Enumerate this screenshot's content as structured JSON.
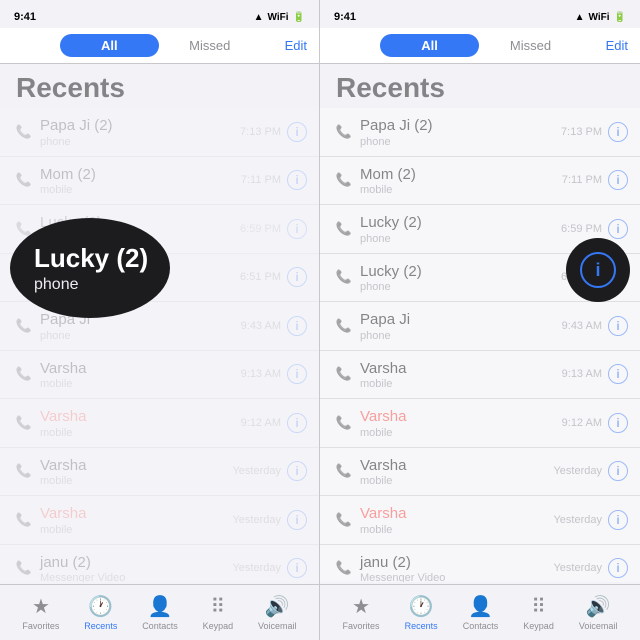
{
  "panels": [
    {
      "id": "left",
      "status": {
        "time": "9:41",
        "signal": "4G",
        "wifi": true,
        "battery": "100%"
      },
      "tabs": {
        "all_label": "All",
        "missed_label": "Missed",
        "edit_label": "Edit",
        "active": "all"
      },
      "title": "Recents",
      "tooltip": {
        "name": "Lucky (2)",
        "type": "phone"
      },
      "calls": [
        {
          "name": "Papa Ji (2)",
          "type": "phone",
          "time": "7:13 PM",
          "missed": false
        },
        {
          "name": "Mom (2)",
          "type": "mobile",
          "time": "7:11 PM",
          "missed": false
        },
        {
          "name": "Lucky (2)",
          "type": "phone",
          "time": "6:59 PM",
          "missed": false
        },
        {
          "name": "Lucky (2)",
          "type": "phone",
          "time": "6:51 PM",
          "missed": false
        },
        {
          "name": "Papa Ji",
          "type": "phone",
          "time": "9:43 AM",
          "missed": false
        },
        {
          "name": "Varsha",
          "type": "mobile",
          "time": "9:13 AM",
          "missed": false
        },
        {
          "name": "Varsha",
          "type": "mobile",
          "time": "9:12 AM",
          "missed": true
        },
        {
          "name": "Varsha",
          "type": "mobile",
          "time": "Yesterday",
          "missed": false
        },
        {
          "name": "Varsha",
          "type": "mobile",
          "time": "Yesterday",
          "missed": true
        },
        {
          "name": "janu (2)",
          "type": "Messenger Video",
          "time": "Yesterday",
          "missed": false
        }
      ],
      "nav": [
        {
          "icon": "★",
          "label": "Favorites",
          "active": false
        },
        {
          "icon": "🕐",
          "label": "Recents",
          "active": true
        },
        {
          "icon": "👤",
          "label": "Contacts",
          "active": false
        },
        {
          "icon": "⠿",
          "label": "Keypad",
          "active": false
        },
        {
          "icon": "🔊",
          "label": "Voicemail",
          "active": false
        }
      ]
    },
    {
      "id": "right",
      "status": {
        "time": "9:41",
        "signal": "4G",
        "wifi": true,
        "battery": "100%"
      },
      "tabs": {
        "all_label": "All",
        "missed_label": "Missed",
        "edit_label": "Edit",
        "active": "all"
      },
      "title": "Recents",
      "calls": [
        {
          "name": "Papa Ji (2)",
          "type": "phone",
          "time": "7:13 PM",
          "missed": false
        },
        {
          "name": "Mom (2)",
          "type": "mobile",
          "time": "7:11 PM",
          "missed": false
        },
        {
          "name": "Lucky (2)",
          "type": "phone",
          "time": "6:59 PM",
          "missed": false
        },
        {
          "name": "Lucky (2)",
          "type": "phone",
          "time": "6:51 PM",
          "missed": false
        },
        {
          "name": "Papa Ji",
          "type": "phone",
          "time": "9:43 AM",
          "missed": false
        },
        {
          "name": "Varsha",
          "type": "mobile",
          "time": "9:13 AM",
          "missed": false
        },
        {
          "name": "Varsha",
          "type": "mobile",
          "time": "9:12 AM",
          "missed": true
        },
        {
          "name": "Varsha",
          "type": "mobile",
          "time": "Yesterday",
          "missed": false
        },
        {
          "name": "Varsha",
          "type": "mobile",
          "time": "Yesterday",
          "missed": true
        },
        {
          "name": "janu (2)",
          "type": "Messenger Video",
          "time": "Yesterday",
          "missed": false
        }
      ],
      "nav": [
        {
          "icon": "★",
          "label": "Favorites",
          "active": false
        },
        {
          "icon": "🕐",
          "label": "Recents",
          "active": true
        },
        {
          "icon": "👤",
          "label": "Contacts",
          "active": false
        },
        {
          "icon": "⠿",
          "label": "Keypad",
          "active": false
        },
        {
          "icon": "🔊",
          "label": "Voicemail",
          "active": false
        }
      ]
    }
  ]
}
